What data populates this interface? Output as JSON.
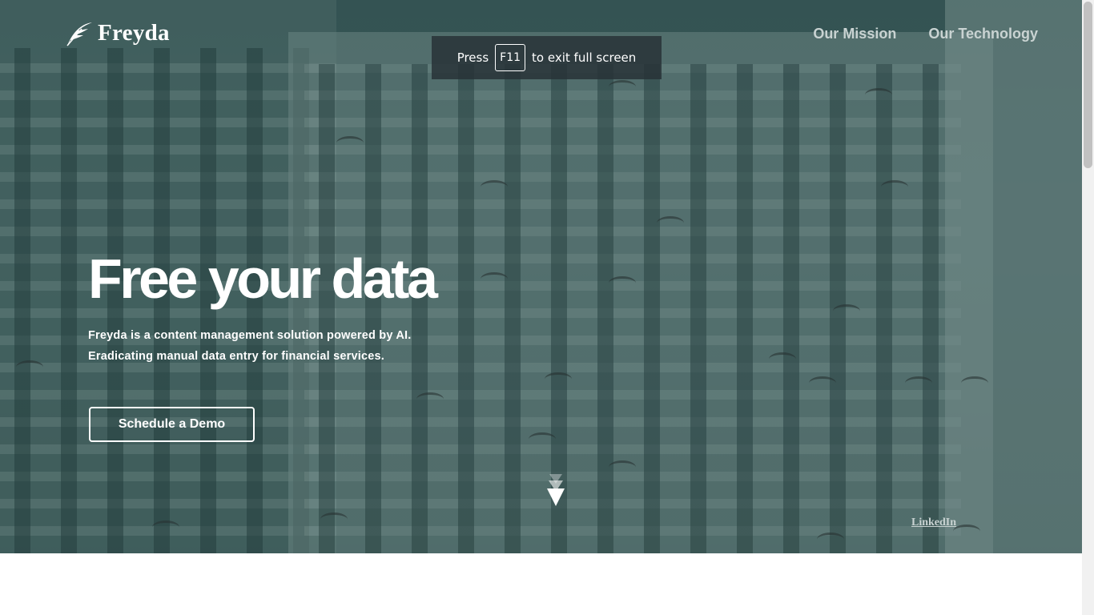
{
  "brand": {
    "name": "Freyda",
    "logo_icon": "feather-icon"
  },
  "nav": {
    "items": [
      {
        "label": "Our Mission"
      },
      {
        "label": "Our Technology"
      }
    ]
  },
  "fullscreen_toast": {
    "prefix": "Press",
    "key": "F11",
    "suffix": "to exit full screen"
  },
  "hero": {
    "headline": "Free your data",
    "subtext_line1": "Freyda is a content management solution powered by AI.",
    "subtext_line2": "Eradicating manual data entry for financial services.",
    "cta_label": "Schedule a Demo",
    "scroll_icon": "down-arrow-icon"
  },
  "footer_link": {
    "label": "LinkedIn"
  },
  "colors": {
    "overlay": "#264848",
    "text": "#ffffff",
    "nav_text": "#c9d3d2"
  }
}
